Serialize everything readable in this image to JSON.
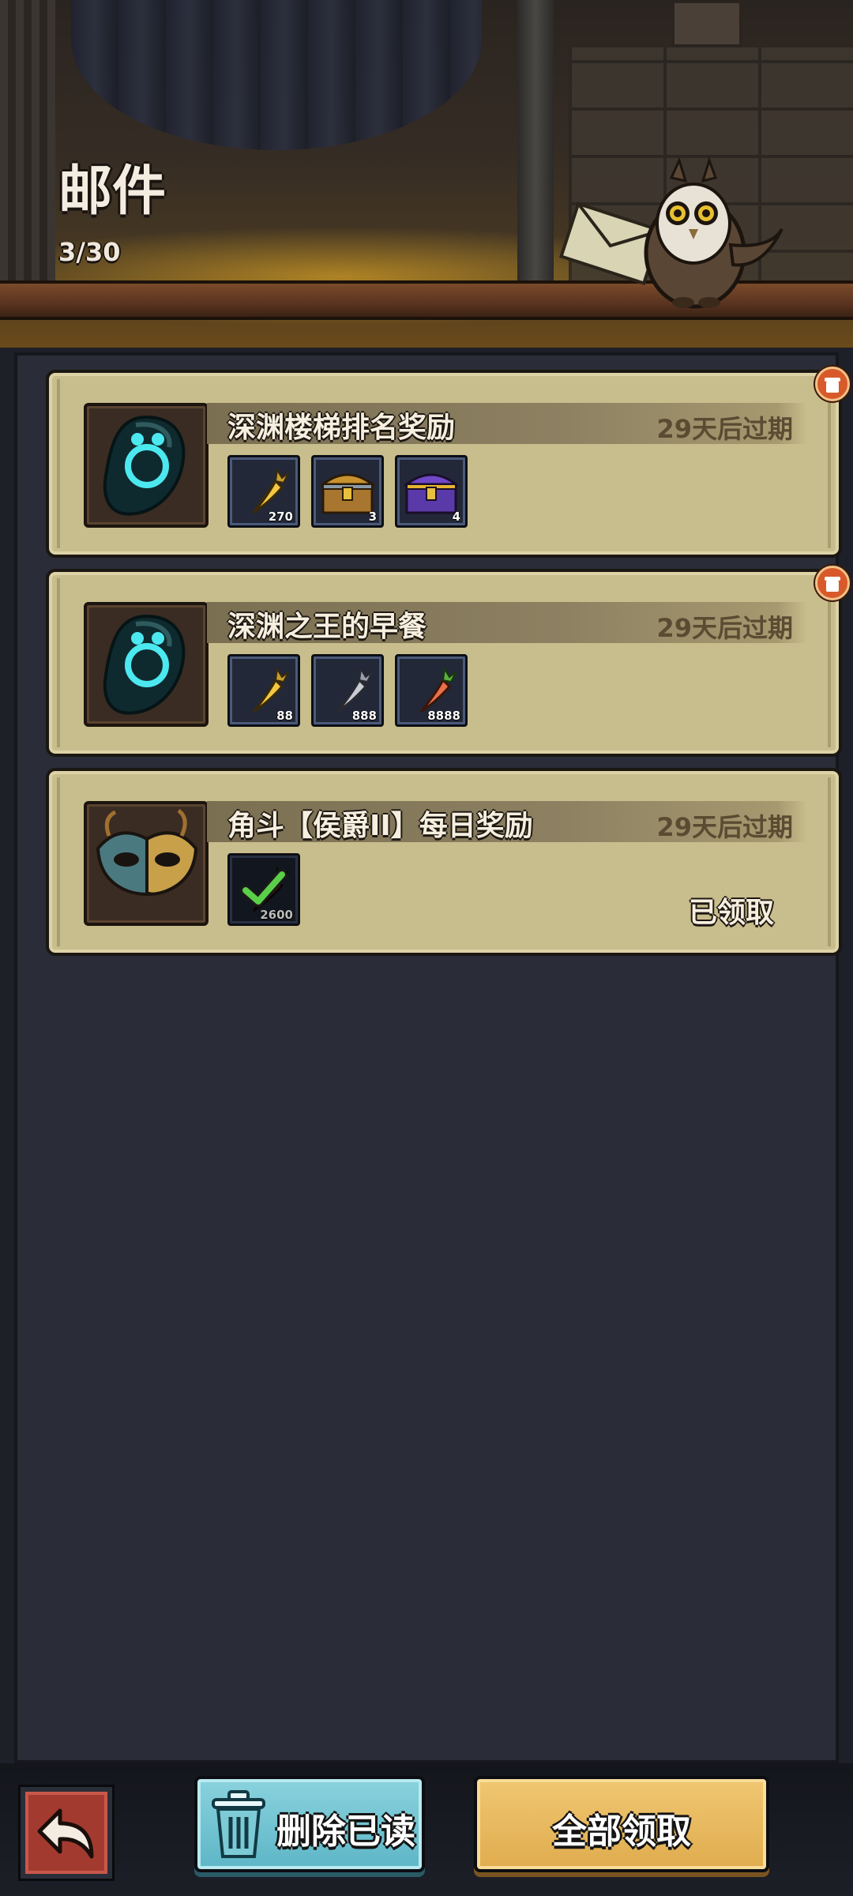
{
  "header": {
    "title": "邮件",
    "count": "3/30"
  },
  "mails": [
    {
      "title": "深渊楼梯排名奖励",
      "expire": "29天后过期",
      "icon": "abyss-stone-icon",
      "has_gift_badge": true,
      "rewards": [
        {
          "icon": "golden-carrot-icon",
          "qty": "270"
        },
        {
          "icon": "wooden-chest-icon",
          "qty": "3"
        },
        {
          "icon": "purple-chest-icon",
          "qty": "4"
        }
      ]
    },
    {
      "title": "深渊之王的早餐",
      "expire": "29天后过期",
      "icon": "abyss-stone-icon",
      "has_gift_badge": true,
      "rewards": [
        {
          "icon": "golden-carrot-icon",
          "qty": "88"
        },
        {
          "icon": "silver-carrot-icon",
          "qty": "888"
        },
        {
          "icon": "orange-carrot-icon",
          "qty": "8888"
        }
      ]
    },
    {
      "title": "角斗【侯爵II】每日奖励",
      "expire": "29天后过期",
      "icon": "gladiator-mask-icon",
      "has_gift_badge": false,
      "status": "已领取",
      "rewards": [
        {
          "icon": "carrot-claimed-icon",
          "qty": "2600",
          "claimed": true
        }
      ]
    }
  ],
  "buttons": {
    "back": "back-arrow-icon",
    "delete_read": "删除已读",
    "claim_all": "全部领取"
  },
  "colors": {
    "card_bg": "#c8bd8c",
    "panel_bg": "#2a2d37",
    "delete_button": "#6cc2d0",
    "claim_button": "#e8b860",
    "back_button": "#a33a30"
  }
}
